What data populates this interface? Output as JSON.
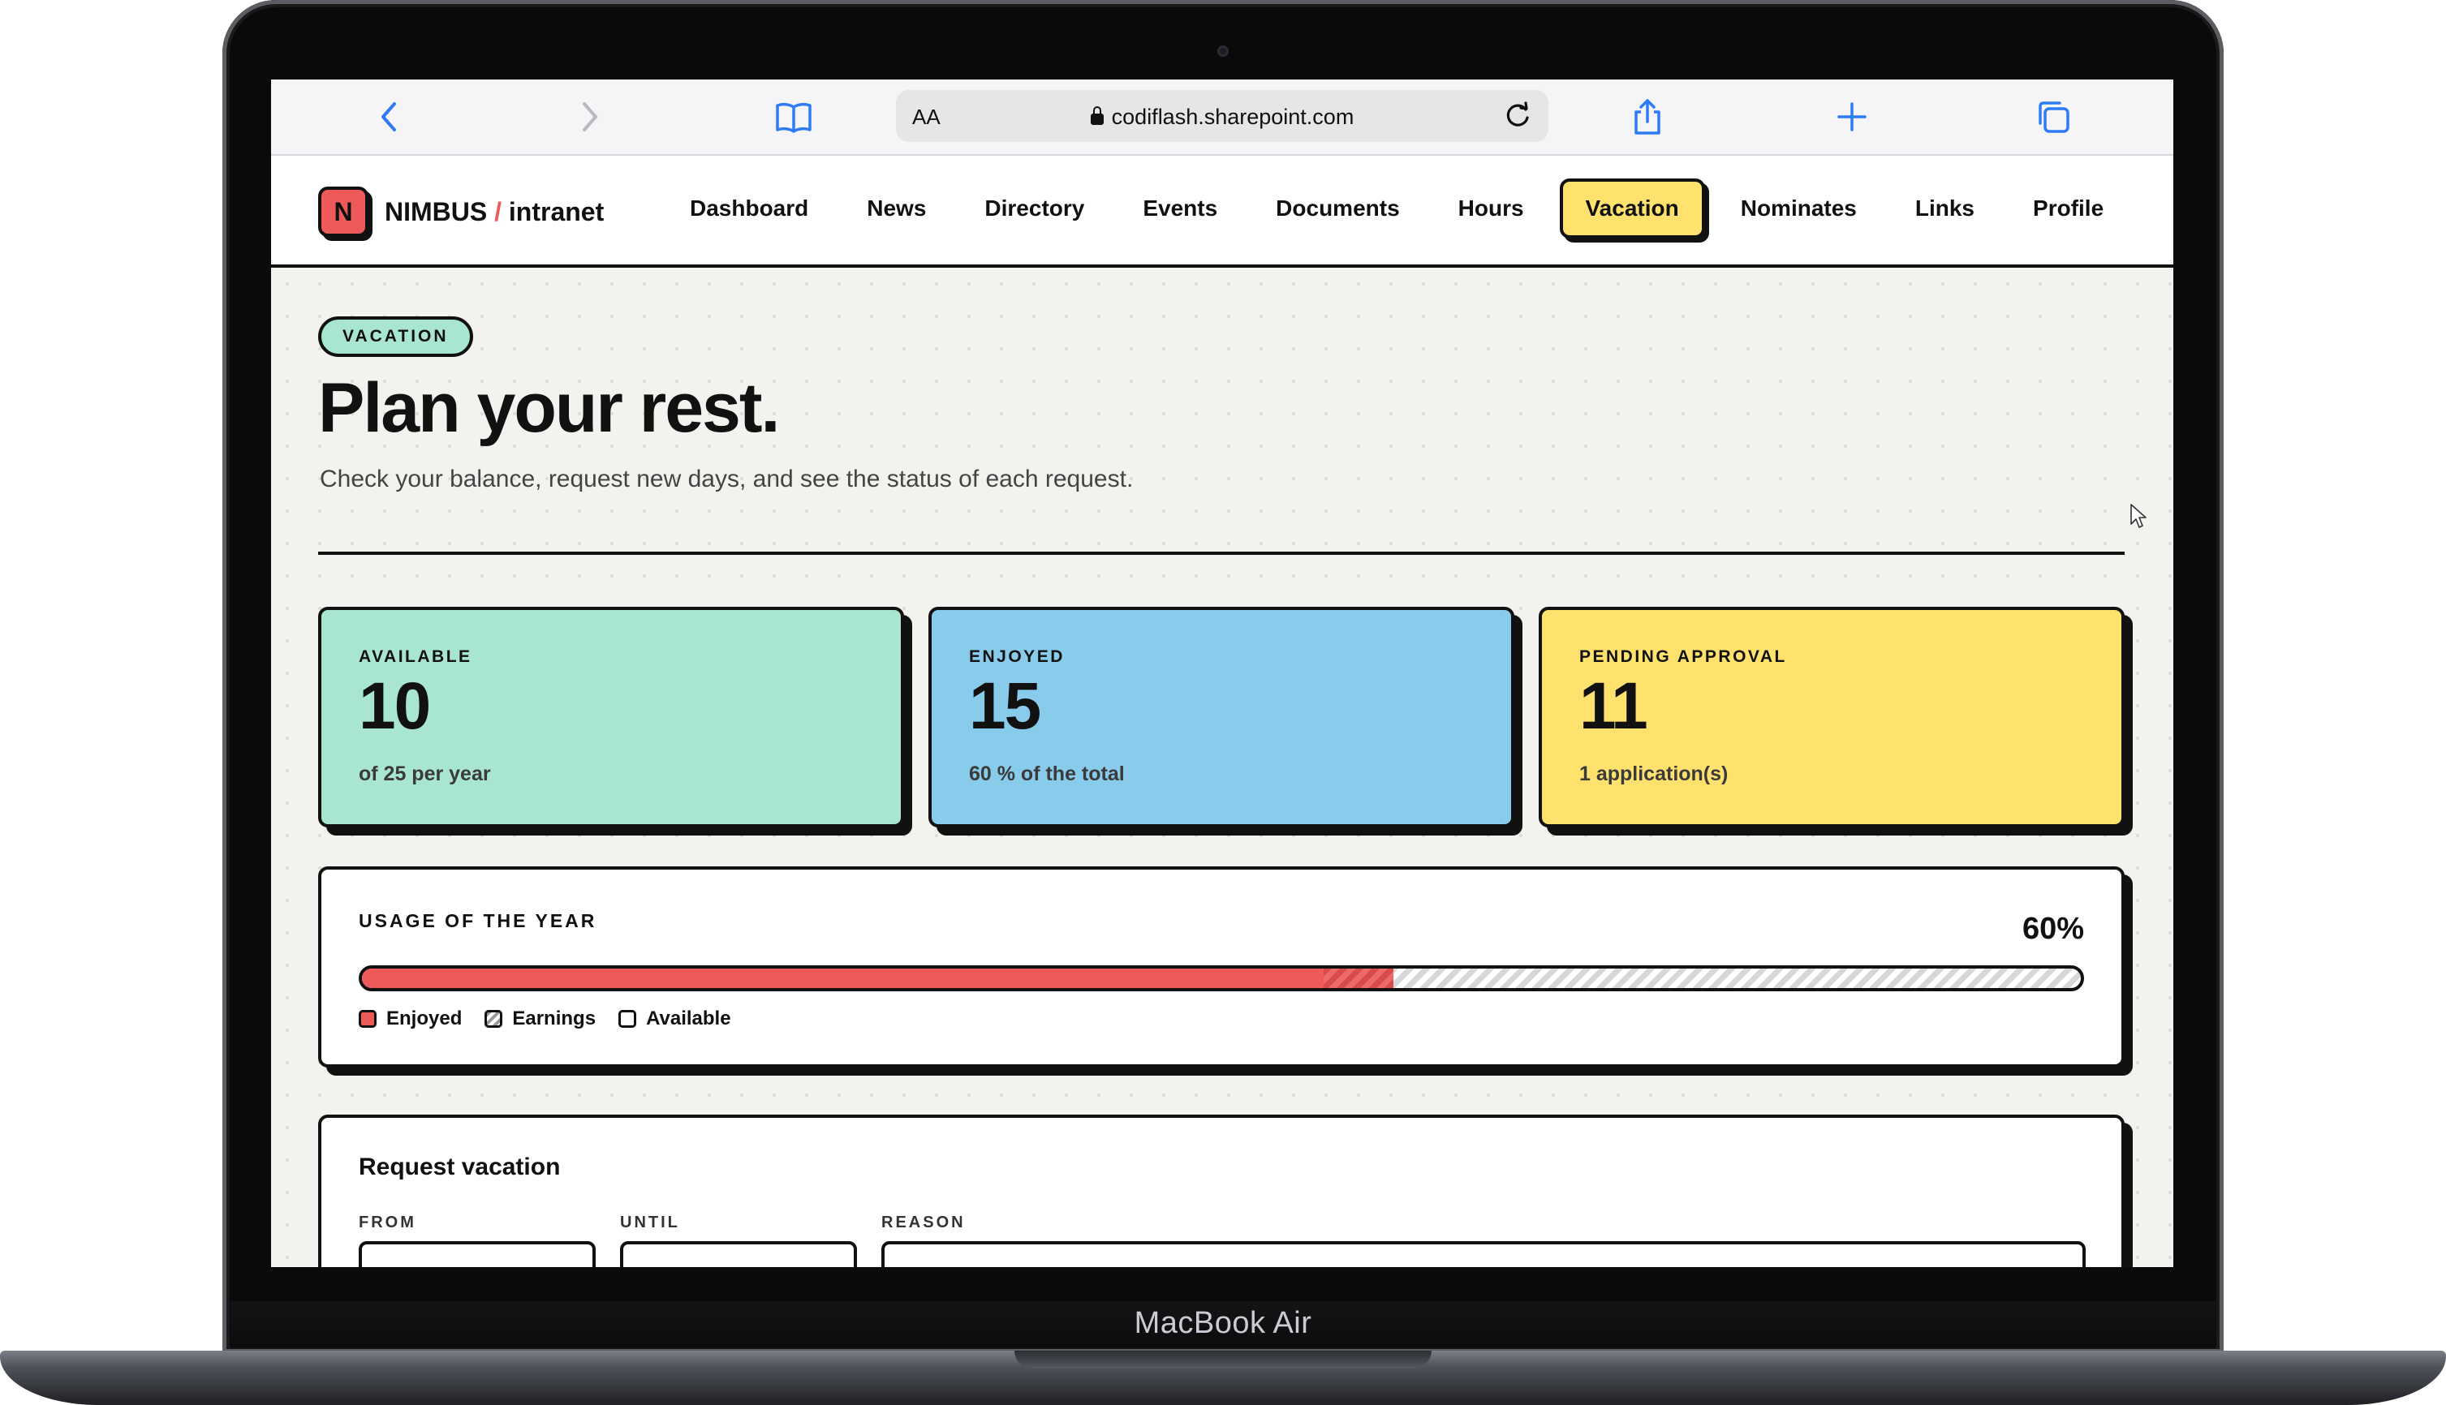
{
  "device": {
    "label": "MacBook Air"
  },
  "browser": {
    "url": "codiflash.sharepoint.com",
    "reader_label": "AA"
  },
  "brand": {
    "logo_letter": "N",
    "name": "NIMBUS",
    "separator": "/",
    "product": "intranet"
  },
  "nav": {
    "items": [
      {
        "label": "Dashboard"
      },
      {
        "label": "News"
      },
      {
        "label": "Directory"
      },
      {
        "label": "Events"
      },
      {
        "label": "Documents"
      },
      {
        "label": "Hours"
      },
      {
        "label": "Vacation"
      },
      {
        "label": "Nominates"
      },
      {
        "label": "Links"
      },
      {
        "label": "Profile"
      }
    ],
    "active": "Vacation"
  },
  "page": {
    "section_pill": "VACATION",
    "title": "Plan your rest.",
    "subtitle": "Check your balance, request new days, and see the status of each request."
  },
  "stats": [
    {
      "label": "AVAILABLE",
      "value": "10",
      "note": "of 25 per year",
      "color": "#a8e6cf"
    },
    {
      "label": "ENJOYED",
      "value": "15",
      "note": "60 % of the total",
      "color": "#89cbeb"
    },
    {
      "label": "PENDING APPROVAL",
      "value": "11",
      "note": "1 application(s)",
      "color": "#ffe16e"
    }
  ],
  "usage": {
    "title": "USAGE OF THE YEAR",
    "percent_label": "60%",
    "enjoyed_fraction": 0.6,
    "legend": {
      "enjoyed": "Enjoyed",
      "earnings": "Earnings",
      "available": "Available"
    }
  },
  "request": {
    "title": "Request vacation",
    "from_label": "FROM",
    "until_label": "UNTIL",
    "reason_label": "REASON"
  },
  "colors": {
    "accent_red": "#ee5a5a",
    "ink": "#111111",
    "page_bg": "#f3f2ef"
  }
}
